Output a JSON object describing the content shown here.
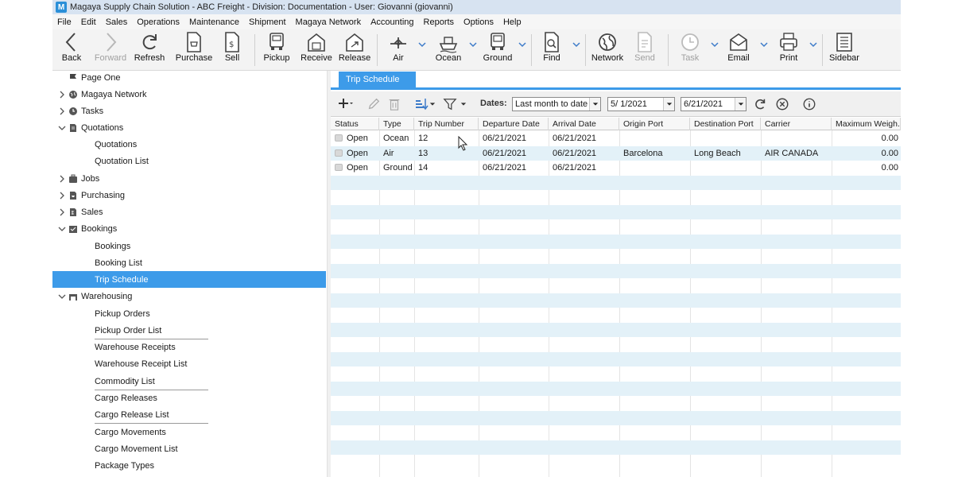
{
  "window": {
    "title": "Magaya Supply Chain Solution - ABC Freight - Division: Documentation - User: Giovanni (giovanni)",
    "logo_letter": "M"
  },
  "menu": [
    "File",
    "Edit",
    "Sales",
    "Operations",
    "Maintenance",
    "Shipment",
    "Magaya Network",
    "Accounting",
    "Reports",
    "Options",
    "Help"
  ],
  "toolbar": {
    "back": "Back",
    "forward": "Forward",
    "refresh": "Refresh",
    "purchase": "Purchase",
    "sell": "Sell",
    "pickup": "Pickup",
    "receive": "Receive",
    "release": "Release",
    "air": "Air",
    "ocean": "Ocean",
    "ground": "Ground",
    "find": "Find",
    "network": "Network",
    "send": "Send",
    "task": "Task",
    "email": "Email",
    "print": "Print",
    "sidebar": "Sidebar"
  },
  "sidebar": {
    "page_one": "Page One",
    "magaya_network": "Magaya Network",
    "tasks": "Tasks",
    "quotations": "Quotations",
    "quotations_sub": "Quotations",
    "quotation_list": "Quotation List",
    "jobs": "Jobs",
    "purchasing": "Purchasing",
    "sales": "Sales",
    "bookings": "Bookings",
    "bookings_sub": "Bookings",
    "booking_list": "Booking List",
    "trip_schedule": "Trip Schedule",
    "warehousing": "Warehousing",
    "pickup_orders": "Pickup Orders",
    "pickup_order_list": "Pickup Order List",
    "warehouse_receipts": "Warehouse Receipts",
    "warehouse_receipt_list": "Warehouse Receipt List",
    "commodity_list": "Commodity List",
    "cargo_releases": "Cargo Releases",
    "cargo_release_list": "Cargo Release List",
    "cargo_movements": "Cargo Movements",
    "cargo_movement_list": "Cargo Movement List",
    "package_types": "Package Types"
  },
  "tab": {
    "label": "Trip Schedule"
  },
  "filters": {
    "dates_label": "Dates:",
    "range": "Last month to date",
    "from": "5/ 1/2021",
    "to": "6/21/2021"
  },
  "grid": {
    "columns": [
      "Status",
      "Type",
      "Trip Number",
      "Departure Date",
      "Arrival Date",
      "Origin Port",
      "Destination Port",
      "Carrier",
      "Maximum Weigh..."
    ],
    "rows": [
      {
        "status": "Open",
        "type": "Ocean",
        "trip": "12",
        "departure": "06/21/2021",
        "arrival": "06/21/2021",
        "origin": "",
        "destination": "",
        "carrier": "",
        "max_weight": "0.00"
      },
      {
        "status": "Open",
        "type": "Air",
        "trip": "13",
        "departure": "06/21/2021",
        "arrival": "06/21/2021",
        "origin": "Barcelona",
        "destination": "Long Beach",
        "carrier": "AIR CANADA",
        "max_weight": "0.00"
      },
      {
        "status": "Open",
        "type": "Ground",
        "trip": "14",
        "departure": "06/21/2021",
        "arrival": "06/21/2021",
        "origin": "",
        "destination": "",
        "carrier": "",
        "max_weight": "0.00"
      }
    ]
  },
  "colors": {
    "accent": "#3d9be9",
    "alt_row": "#e3f1f8",
    "titlebar": "#d7e3f1"
  }
}
